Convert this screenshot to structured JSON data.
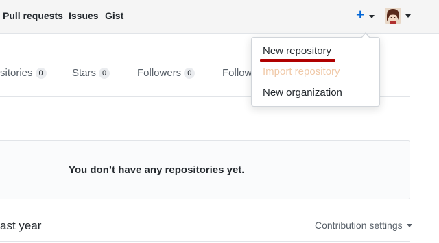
{
  "header": {
    "nav": [
      "Pull requests",
      "Issues",
      "Gist"
    ],
    "plus_icon": "+",
    "colors": {
      "accent": "#0366d6",
      "background": "#f5f5f5"
    }
  },
  "tabs": [
    {
      "label": "sitories",
      "count": "0"
    },
    {
      "label": "Stars",
      "count": "0"
    },
    {
      "label": "Followers",
      "count": "0"
    },
    {
      "label": "Follow",
      "count": ""
    }
  ],
  "dropdown": {
    "items": [
      "New repository",
      "Import repository",
      "New organization"
    ],
    "highlight_color": "#b00000"
  },
  "repositories": {
    "empty_message": "You don’t have any repositories yet."
  },
  "contributions": {
    "title": "ast year",
    "settings_label": "Contribution settings"
  },
  "icons": [
    "plus-icon",
    "caret-down-icon",
    "avatar"
  ]
}
